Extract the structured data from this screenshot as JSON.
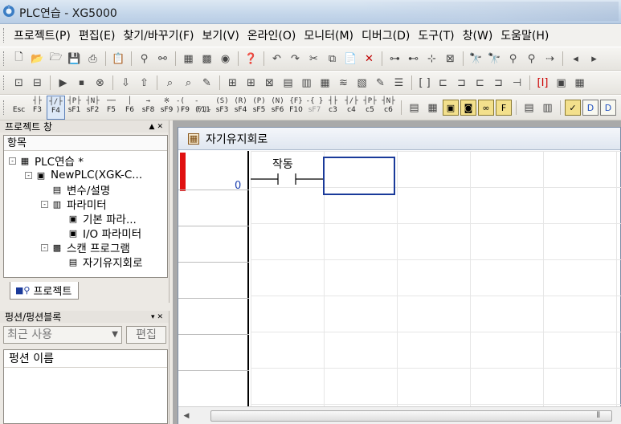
{
  "window": {
    "title": "PLC연습 - XG5000"
  },
  "menu": [
    "프로젝트(P)",
    "편집(E)",
    "찾기/바꾸기(F)",
    "보기(V)",
    "온라인(O)",
    "모니터(M)",
    "디버그(D)",
    "도구(T)",
    "창(W)",
    "도움말(H)"
  ],
  "ladder_toolbar": [
    {
      "sym": "",
      "key": "Esc"
    },
    {
      "sym": "┤├",
      "key": "F3"
    },
    {
      "sym": "┤/├",
      "key": "F4"
    },
    {
      "sym": "┤P├",
      "key": "sF1"
    },
    {
      "sym": "┤N├",
      "key": "sF2"
    },
    {
      "sym": "──",
      "key": "F5"
    },
    {
      "sym": "│",
      "key": "F6"
    },
    {
      "sym": "→",
      "key": "sF8"
    },
    {
      "sym": "※",
      "key": "sF9"
    },
    {
      "sym": "-( )-",
      "key": "F9"
    },
    {
      "sym": "-(/)-",
      "key": "F11"
    },
    {
      "sym": "(S)",
      "key": "sF3"
    },
    {
      "sym": "(R)",
      "key": "sF4"
    },
    {
      "sym": "(P)",
      "key": "sF5"
    },
    {
      "sym": "(N)",
      "key": "sF6"
    },
    {
      "sym": "{F}",
      "key": "F10"
    },
    {
      "sym": "-{ }",
      "key": "sF7"
    },
    {
      "sym": "┤├",
      "key": "c3"
    },
    {
      "sym": "┤/├",
      "key": "c4"
    },
    {
      "sym": "┤P├",
      "key": "c5"
    },
    {
      "sym": "┤N├",
      "key": "c6"
    }
  ],
  "project_panel": {
    "title": "프로젝트 창",
    "column": "항목",
    "tree": [
      {
        "label": "PLC연습 *",
        "level": 0,
        "toggle": "-",
        "icon": "plc-project-icon",
        "glyph": "▦"
      },
      {
        "label": "NewPLC(XGK-C...",
        "level": 1,
        "toggle": "-",
        "icon": "cpu-icon",
        "glyph": "▣"
      },
      {
        "label": "변수/설명",
        "level": 2,
        "toggle": "",
        "icon": "variable-icon",
        "glyph": "▤"
      },
      {
        "label": "파라미터",
        "level": 2,
        "toggle": "-",
        "icon": "parameter-icon",
        "glyph": "▥"
      },
      {
        "label": "기본 파라...",
        "level": 3,
        "toggle": "",
        "icon": "basic-param-icon",
        "glyph": "▣"
      },
      {
        "label": "I/O 파라미터",
        "level": 3,
        "toggle": "",
        "icon": "io-param-icon",
        "glyph": "▣"
      },
      {
        "label": "스캔 프로그램",
        "level": 2,
        "toggle": "-",
        "icon": "scan-program-icon",
        "glyph": "▩"
      },
      {
        "label": "자기유지회로",
        "level": 3,
        "toggle": "",
        "icon": "ladder-program-icon",
        "glyph": "▤"
      }
    ],
    "tab": "프로젝트"
  },
  "function_panel": {
    "title": "펑션/펑션블록",
    "filter": "최근 사용",
    "edit": "편집",
    "column": "펑션 이름"
  },
  "ladder_window": {
    "title": "자기유지회로",
    "step": "0",
    "contact_label": "작동"
  }
}
